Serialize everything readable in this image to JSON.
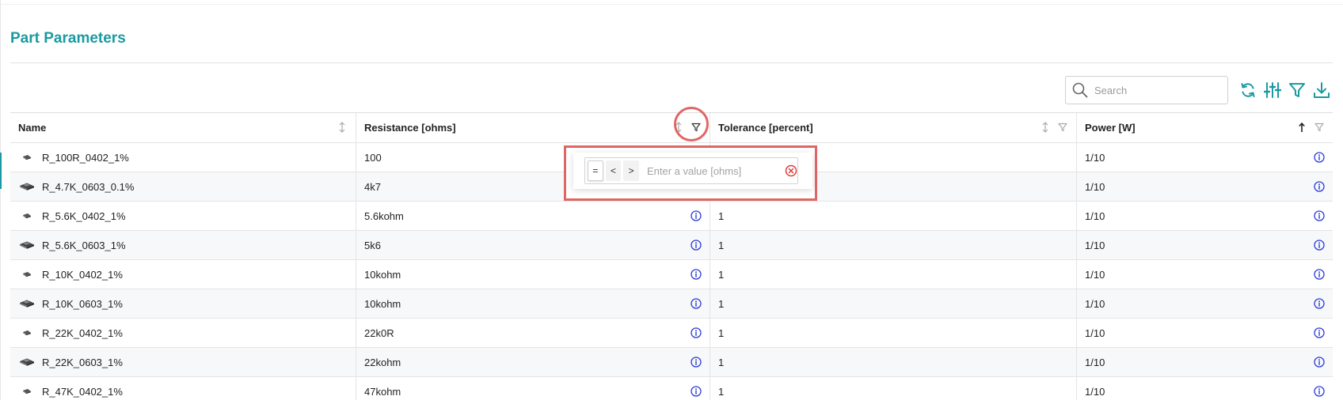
{
  "page": {
    "title": "Part Parameters"
  },
  "search": {
    "placeholder": "Search"
  },
  "toolbar": {
    "icons": [
      "refresh-icon",
      "sliders-icon",
      "filter-icon",
      "download-icon"
    ]
  },
  "table": {
    "columns": [
      {
        "label": "Name",
        "sort": "none",
        "filter": false
      },
      {
        "label": "Resistance [ohms]",
        "sort": "none",
        "filter": true
      },
      {
        "label": "Tolerance [percent]",
        "sort": "none",
        "filter": true
      },
      {
        "label": "Power [W]",
        "sort": "ascending",
        "filter": true
      }
    ],
    "rows": [
      {
        "name": "R_100R_0402_1%",
        "package": "0402",
        "resistance": "100",
        "tolerance": "",
        "power": "1/10"
      },
      {
        "name": "R_4.7K_0603_0.1%",
        "package": "0603",
        "resistance": "4k7",
        "tolerance": "",
        "power": "1/10"
      },
      {
        "name": "R_5.6K_0402_1%",
        "package": "0402",
        "resistance": "5.6kohm",
        "tolerance": "1",
        "power": "1/10"
      },
      {
        "name": "R_5.6K_0603_1%",
        "package": "0603",
        "resistance": "5k6",
        "tolerance": "1",
        "power": "1/10"
      },
      {
        "name": "R_10K_0402_1%",
        "package": "0402",
        "resistance": "10kohm",
        "tolerance": "1",
        "power": "1/10"
      },
      {
        "name": "R_10K_0603_1%",
        "package": "0603",
        "resistance": "10kohm",
        "tolerance": "1",
        "power": "1/10"
      },
      {
        "name": "R_22K_0402_1%",
        "package": "0402",
        "resistance": "22k0R",
        "tolerance": "1",
        "power": "1/10"
      },
      {
        "name": "R_22K_0603_1%",
        "package": "0603",
        "resistance": "22kohm",
        "tolerance": "1",
        "power": "1/10"
      },
      {
        "name": "R_47K_0402_1%",
        "package": "0402",
        "resistance": "47kohm",
        "tolerance": "1",
        "power": "1/10"
      }
    ]
  },
  "filter_popup": {
    "operators": [
      "=",
      "<",
      ">"
    ],
    "active_operator": "=",
    "placeholder": "Enter a value [ohms]",
    "value": ""
  },
  "colors": {
    "accent": "#1a9aa0",
    "info": "#2b3bd6",
    "highlight": "#e06666"
  }
}
